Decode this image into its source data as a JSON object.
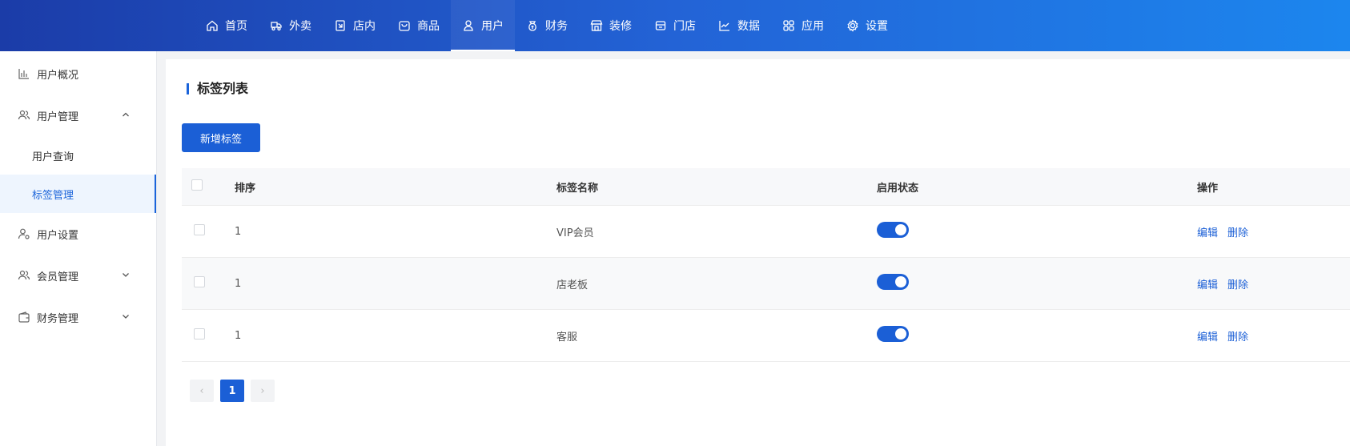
{
  "nav": [
    {
      "label": "首页",
      "icon": "home-icon"
    },
    {
      "label": "外卖",
      "icon": "delivery-icon"
    },
    {
      "label": "店内",
      "icon": "dine-in-icon"
    },
    {
      "label": "商品",
      "icon": "goods-icon"
    },
    {
      "label": "用户",
      "icon": "user-icon",
      "active": true
    },
    {
      "label": "财务",
      "icon": "money-bag-icon"
    },
    {
      "label": "装修",
      "icon": "store-decor-icon"
    },
    {
      "label": "门店",
      "icon": "shop-icon"
    },
    {
      "label": "数据",
      "icon": "chart-icon"
    },
    {
      "label": "应用",
      "icon": "apps-icon"
    },
    {
      "label": "设置",
      "icon": "gear-icon"
    }
  ],
  "sidebar": {
    "overview": "用户概况",
    "user_mgmt": "用户管理",
    "user_query": "用户查询",
    "tag_mgmt": "标签管理",
    "user_settings": "用户设置",
    "member_mgmt": "会员管理",
    "finance_mgmt": "财务管理"
  },
  "main": {
    "title": "标签列表",
    "add_button": "新增标签",
    "columns": [
      "排序",
      "标签名称",
      "启用状态",
      "操作"
    ],
    "rows": [
      {
        "sort": "1",
        "name": "VIP会员",
        "enabled": true
      },
      {
        "sort": "1",
        "name": "店老板",
        "enabled": true
      },
      {
        "sort": "1",
        "name": "客服",
        "enabled": true
      }
    ],
    "edit_label": "编辑",
    "delete_label": "删除",
    "pager": {
      "prev": "‹",
      "current": "1",
      "next": "›"
    }
  },
  "colors": {
    "accent": "#1b5fd6",
    "nav_gradient_start": "#1b3ca8",
    "nav_gradient_end": "#1c86ee"
  }
}
